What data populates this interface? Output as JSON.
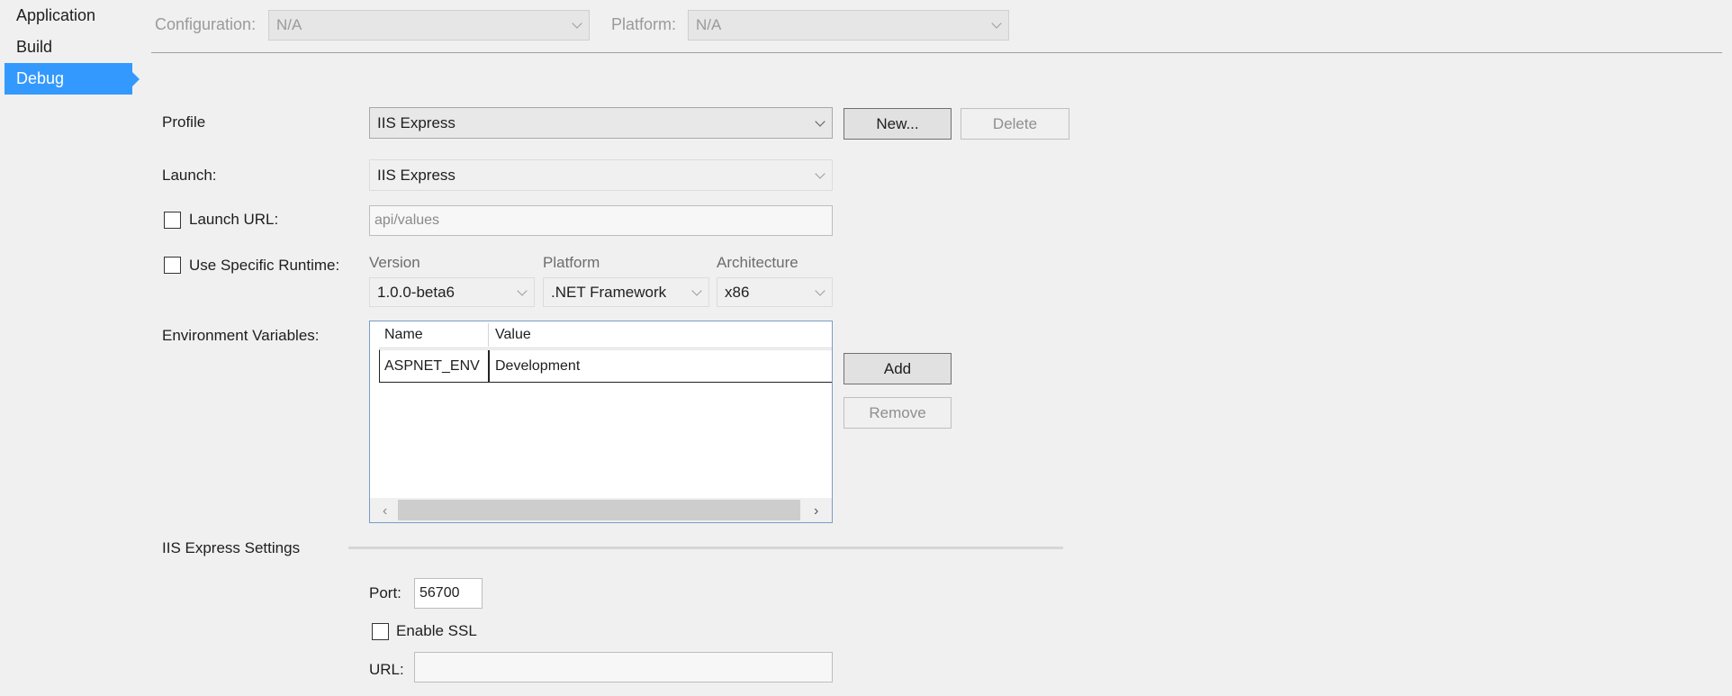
{
  "nav": {
    "items": [
      {
        "label": "Application"
      },
      {
        "label": "Build"
      },
      {
        "label": "Debug"
      }
    ]
  },
  "header": {
    "configuration_label": "Configuration:",
    "configuration_value": "N/A",
    "platform_label": "Platform:",
    "platform_value": "N/A"
  },
  "profile": {
    "label": "Profile",
    "value": "IIS Express",
    "new_label": "New...",
    "delete_label": "Delete"
  },
  "launch": {
    "label": "Launch:",
    "value": "IIS Express"
  },
  "launch_url": {
    "label": "Launch URL:",
    "value": "api/values"
  },
  "runtime": {
    "label": "Use Specific Runtime:",
    "version_label": "Version",
    "version_value": "1.0.0-beta6",
    "platform_label": "Platform",
    "platform_value": ".NET Framework",
    "arch_label": "Architecture",
    "arch_value": "x86"
  },
  "env": {
    "label": "Environment Variables:",
    "columns": [
      "Name",
      "Value"
    ],
    "rows": [
      {
        "name": "ASPNET_ENV",
        "value": "Development"
      }
    ],
    "add_label": "Add",
    "remove_label": "Remove"
  },
  "iis": {
    "section_label": "IIS Express Settings",
    "port_label": "Port:",
    "port_value": "56700",
    "ssl_label": "Enable SSL",
    "url_label": "URL:",
    "url_value": ""
  },
  "colors": {
    "accent": "#3399ff",
    "background": "#f0f0f0"
  }
}
